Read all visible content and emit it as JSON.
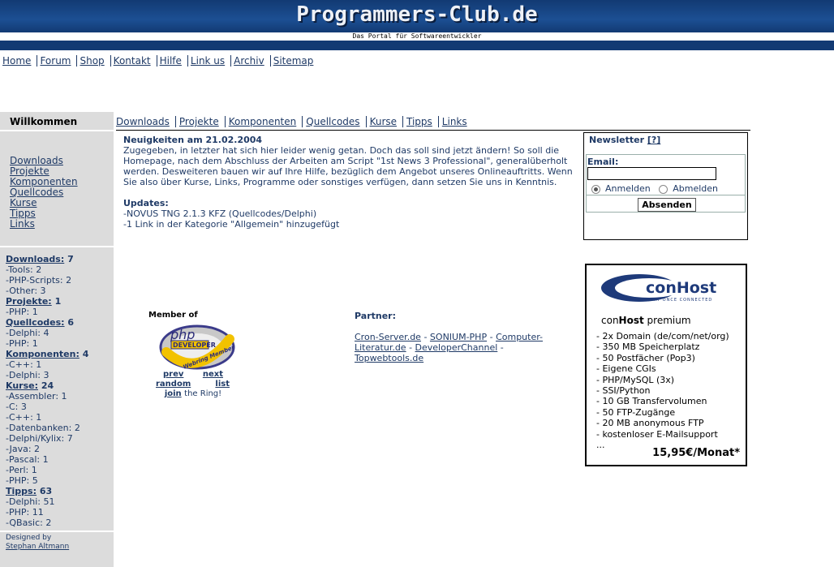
{
  "site": {
    "logo": "Programmers-Club.de",
    "subtitle": "Das Portal für Softwareentwickler"
  },
  "topnav": [
    "Home",
    "Forum",
    "Shop",
    "Kontakt",
    "Hilfe",
    "Link us",
    "Archiv",
    "Sitemap"
  ],
  "sidebar": {
    "title": "Willkommen",
    "links": [
      "Downloads",
      "Projekte",
      "Komponenten",
      "Quellcodes",
      "Kurse",
      "Tipps",
      "Links"
    ],
    "stats": [
      {
        "label": "Downloads:",
        "count": "7",
        "items": [
          "-Tools: 2",
          "-PHP-Scripts: 2",
          "-Other: 3"
        ]
      },
      {
        "label": "Projekte:",
        "count": "1",
        "items": [
          "-PHP: 1"
        ]
      },
      {
        "label": "Quellcodes:",
        "count": "6",
        "items": [
          "-Delphi: 4",
          "-PHP: 1"
        ]
      },
      {
        "label": "Komponenten:",
        "count": "4",
        "items": [
          "-C++: 1",
          "-Delphi: 3"
        ]
      },
      {
        "label": "Kurse:",
        "count": "24",
        "items": [
          "-Assembler: 1",
          "-C: 3",
          "-C++: 1",
          "-Datenbanken: 2",
          "-Delphi/Kylix: 7",
          "-Java: 2",
          "-Pascal: 1",
          "-Perl: 1",
          "-PHP: 5"
        ]
      },
      {
        "label": "Tipps:",
        "count": "63",
        "items": [
          "-Delphi: 51",
          "-PHP: 11",
          "-QBasic: 2"
        ]
      }
    ],
    "credit_label": "Designed by",
    "credit_name": "Stephan Altmann"
  },
  "catnav": [
    "Downloads",
    "Projekte",
    "Komponenten",
    "Quellcodes",
    "Kurse",
    "Tipps",
    "Links"
  ],
  "news": {
    "title": "Neuigkeiten am 21.02.2004",
    "body": "Zugegeben, in letzter hat sich hier leider wenig getan. Doch das soll sind jetzt ändern! So soll die Homepage, nach dem Abschluss der Arbeiten am Script \"1st News 3 Professional\", generalüberholt werden. Desweiteren bauen wir auf Ihre Hilfe, bezüglich dem Angebot unseres Onlineauftritts. Wenn Sie also über Kurse, Links, Programme oder sonstiges verfügen, dann setzen Sie uns in Kenntnis.",
    "updates_title": "Updates:",
    "updates": [
      "-NOVUS TNG 2.1.3 KFZ (Quellcodes/Delphi)",
      "-1 Link in der Kategorie \"Allgemein\" hinzugefügt"
    ]
  },
  "newsletter": {
    "title": "Newsletter",
    "help": "[?]",
    "email_label": "Email:",
    "email_value": "",
    "option_subscribe": "Anmelden",
    "option_unsubscribe": "Abmelden",
    "selected": "Anmelden",
    "submit": "Absenden"
  },
  "member": {
    "title": "Member of",
    "badge_line1": "php",
    "badge_line2": "DEVELOPER",
    "badge_ring": "Webring Member",
    "prev": "prev",
    "next": "next",
    "random": "random",
    "list": "list",
    "join": "join",
    "join_suffix": "the Ring!"
  },
  "partner": {
    "title": "Partner:",
    "links": [
      "Cron-Server.de",
      "SONIUM-PHP",
      "Computer-Literatur.de",
      "DeveloperChannel",
      "Topwebtools.de"
    ]
  },
  "ad": {
    "logo_main": "conHost",
    "logo_tagline": "AT ONCE CONNECTED",
    "name_prefix": "con",
    "name_bold": "Host",
    "name_suffix": " premium",
    "features": [
      "- 2x Domain (de/com/net/org)",
      "- 350 MB Speicherplatz",
      "- 50 Postfächer (Pop3)",
      "- Eigene CGIs",
      "- PHP/MySQL (3x)",
      "- SSI/Python",
      "- 10 GB Transfervolumen",
      "- 50 FTP-Zugänge",
      "- 20 MB anonymous FTP",
      "- kostenloser E-Mailsupport",
      "..."
    ],
    "price": "15,95€/Monat*"
  }
}
